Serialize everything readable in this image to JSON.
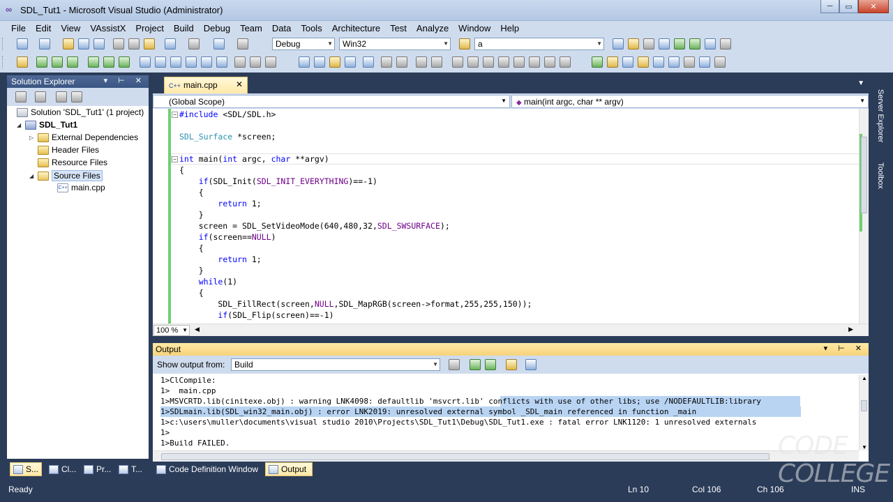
{
  "window": {
    "title": "SDL_Tut1 - Microsoft Visual Studio (Administrator)",
    "controls": {
      "minimize": "─",
      "maximize": "▭",
      "close": "✕"
    }
  },
  "menu": [
    "File",
    "Edit",
    "View",
    "VAssistX",
    "Project",
    "Build",
    "Debug",
    "Team",
    "Data",
    "Tools",
    "Architecture",
    "Test",
    "Analyze",
    "Window",
    "Help"
  ],
  "toolbar": {
    "config": "Debug",
    "platform": "Win32",
    "find_value": "a"
  },
  "solution_explorer": {
    "title": "Solution Explorer",
    "solution": "Solution 'SDL_Tut1' (1 project)",
    "project": "SDL_Tut1",
    "items": [
      "External Dependencies",
      "Header Files",
      "Resource Files",
      "Source Files"
    ],
    "file": "main.cpp"
  },
  "editor": {
    "tab": "main.cpp",
    "scope": "(Global Scope)",
    "function": "main(int argc, char ** argv)",
    "zoom": "100 %",
    "lines": [
      "#include <SDL/SDL.h>",
      "",
      "SDL_Surface *screen;",
      "",
      "int main(int argc, char **argv)",
      "{",
      "    if(SDL_Init(SDL_INIT_EVERYTHING)==-1)",
      "    {",
      "        return 1;",
      "    }",
      "    screen = SDL_SetVideoMode(640,480,32,SDL_SWSURFACE);",
      "    if(screen==NULL)",
      "    {",
      "        return 1;",
      "    }",
      "    while(1)",
      "    {",
      "        SDL_FillRect(screen,NULL,SDL_MapRGB(screen->format,255,255,150));",
      "        if(SDL_Flip(screen)==-1)"
    ]
  },
  "side_tabs": [
    "Server Explorer",
    "Toolbox"
  ],
  "output": {
    "title": "Output",
    "show_from_label": "Show output from:",
    "show_from_value": "Build",
    "lines": [
      "1>ClCompile:",
      "1>  main.cpp",
      "1>MSVCRTD.lib(cinitexe.obj) : warning LNK4098: defaultlib 'msvcrt.lib' conflicts with use of other libs; use /NODEFAULTLIB:library",
      "1>SDLmain.lib(SDL_win32_main.obj) : error LNK2019: unresolved external symbol _SDL_main referenced in function _main",
      "1>c:\\users\\muller\\documents\\visual studio 2010\\Projects\\SDL_Tut1\\Debug\\SDL_Tut1.exe : fatal error LNK1120: 1 unresolved externals",
      "1>",
      "1>Build FAILED."
    ]
  },
  "bottom_tabs": [
    "S...",
    "Cl...",
    "Pr...",
    "T...",
    "Code Definition Window",
    "Output"
  ],
  "status": {
    "text": "Ready",
    "line": "Ln 10",
    "col": "Col 106",
    "ch": "Ch 106",
    "mode": "INS"
  },
  "watermark": [
    "CODE",
    "COLLEGE"
  ]
}
